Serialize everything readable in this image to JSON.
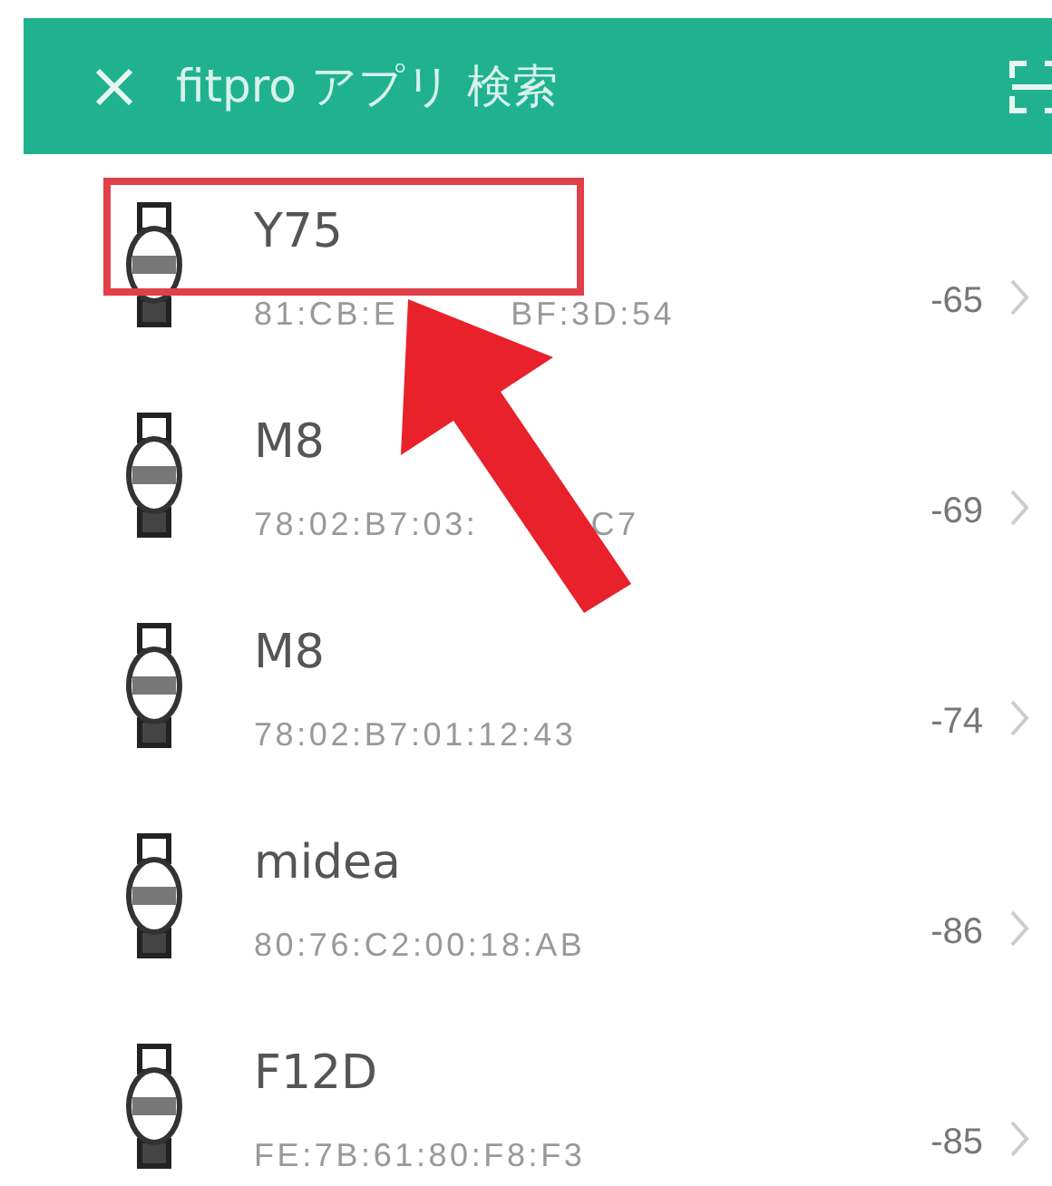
{
  "header": {
    "title": "fitpro アプリ 検索"
  },
  "devices": [
    {
      "name": "Y75",
      "mac_parts": [
        "81:CB:E",
        "BF:3D:54"
      ],
      "rssi": "-65"
    },
    {
      "name": "M8",
      "mac_parts": [
        "78:02:B7:03:",
        "C7"
      ],
      "rssi": "-69"
    },
    {
      "name": "M8",
      "mac_parts": [
        "78:02:B7:01:12:43"
      ],
      "rssi": "-74"
    },
    {
      "name": "midea",
      "mac_parts": [
        "80:76:C2:00:18:AB"
      ],
      "rssi": "-86"
    },
    {
      "name": "F12D",
      "mac_parts": [
        "FE:7B:61:80:F8:F3"
      ],
      "rssi": "-85"
    }
  ]
}
